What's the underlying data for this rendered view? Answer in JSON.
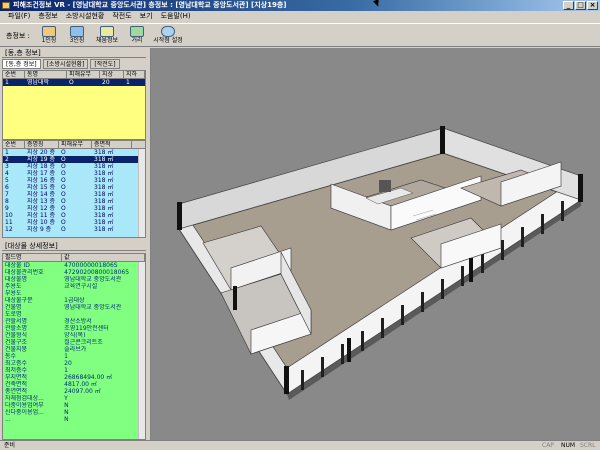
{
  "window": {
    "title": "피해조건정보 VR - [영남대학교 중앙도서관] 층정보 : [영남대학교 중앙도서관] [지상19층]",
    "controls": [
      "_",
      "□",
      "×"
    ]
  },
  "menu": [
    "파일(F)",
    "층정보",
    "소방시설현황",
    "작전도",
    "보기",
    "도움말(H)"
  ],
  "toolbar": {
    "label": "층정보 :",
    "buttons": [
      {
        "label": "1인칭",
        "icon": "person-icon"
      },
      {
        "label": "3인칭",
        "icon": "people-icon"
      },
      {
        "label": "채움정보",
        "icon": "fill-info-icon"
      },
      {
        "label": "거리",
        "icon": "distance-icon"
      },
      {
        "label": "시작점 설정",
        "icon": "start-point-icon"
      }
    ]
  },
  "building_section": {
    "header": "[동,층 정보]",
    "tabs": [
      "[동,층 정보]",
      "[소방시설현황]",
      "[작전도]"
    ],
    "columns": [
      "순번",
      "동명",
      "피해유무",
      "지상",
      "지하"
    ],
    "rows": [
      {
        "no": "1",
        "name": "영남대학",
        "damage": "O",
        "above": "20",
        "below": "1"
      }
    ]
  },
  "floor_section": {
    "columns": [
      "순번",
      "층명칭",
      "피해유무",
      "층면적"
    ],
    "rows": [
      {
        "no": "1",
        "floor": "지상 20 층",
        "damage": "O",
        "area": "318 ㎡"
      },
      {
        "no": "2",
        "floor": "지상 19 층",
        "damage": "O",
        "area": "318 ㎡"
      },
      {
        "no": "3",
        "floor": "지상 18 층",
        "damage": "O",
        "area": "318 ㎡"
      },
      {
        "no": "4",
        "floor": "지상 17 층",
        "damage": "O",
        "area": "318 ㎡"
      },
      {
        "no": "5",
        "floor": "지상 16 층",
        "damage": "O",
        "area": "318 ㎡"
      },
      {
        "no": "6",
        "floor": "지상 15 층",
        "damage": "O",
        "area": "318 ㎡"
      },
      {
        "no": "7",
        "floor": "지상 14 층",
        "damage": "O",
        "area": "318 ㎡"
      },
      {
        "no": "8",
        "floor": "지상 13 층",
        "damage": "O",
        "area": "318 ㎡"
      },
      {
        "no": "9",
        "floor": "지상 12 층",
        "damage": "O",
        "area": "318 ㎡"
      },
      {
        "no": "10",
        "floor": "지상 11 층",
        "damage": "O",
        "area": "318 ㎡"
      },
      {
        "no": "11",
        "floor": "지상 10 층",
        "damage": "O",
        "area": "318 ㎡"
      },
      {
        "no": "12",
        "floor": "지상 9 층",
        "damage": "O",
        "area": "318 ㎡"
      }
    ],
    "selected_index": 1
  },
  "detail_section": {
    "header": "[대상물 상세정보]",
    "columns": [
      "필드명",
      "값"
    ],
    "rows": [
      {
        "field": "대상물 ID",
        "value": "4700000001806S"
      },
      {
        "field": "대상물관리번호",
        "value": "47290200800018065"
      },
      {
        "field": "대상물명",
        "value": "영남대학교 중앙도서관"
      },
      {
        "field": "주용도",
        "value": "교육연구시설"
      },
      {
        "field": "부용도",
        "value": ""
      },
      {
        "field": "대상물구분",
        "value": "1급대상"
      },
      {
        "field": "건물명",
        "value": "영남대학교 중앙도서관"
      },
      {
        "field": "도로명",
        "value": ""
      },
      {
        "field": "관할서명",
        "value": "경산소방서"
      },
      {
        "field": "관할소명",
        "value": "조영119안전센터"
      },
      {
        "field": "건물형식",
        "value": "양식(목)"
      },
      {
        "field": "건물구조",
        "value": "철근콘크리트조"
      },
      {
        "field": "건물지붕",
        "value": "슬라브가"
      },
      {
        "field": "동수",
        "value": "1"
      },
      {
        "field": "최고층수",
        "value": "20"
      },
      {
        "field": "최저층수",
        "value": "1"
      },
      {
        "field": "부지면적",
        "value": "26868494.00 ㎡"
      },
      {
        "field": "건축면적",
        "value": "4817.00 ㎡"
      },
      {
        "field": "총연면적",
        "value": "24097.00 ㎡"
      },
      {
        "field": "자체점검대상...",
        "value": "Y"
      },
      {
        "field": "다중이용업여부",
        "value": "N"
      },
      {
        "field": "신다중이용업...",
        "value": "N"
      },
      {
        "field": "...",
        "value": "N"
      }
    ]
  },
  "status": {
    "text": "준비",
    "indicators": [
      {
        "label": "CAP",
        "on": false
      },
      {
        "label": "NUM",
        "on": true
      },
      {
        "label": "SCRL",
        "on": false
      }
    ]
  },
  "colors": {
    "title_start": "#0a246a",
    "building_grid": "#ffff80",
    "floor_grid": "#a8e8f8",
    "detail_grid": "#80ff80",
    "viewport_bg": "#898989",
    "selection": "#0a246a"
  }
}
